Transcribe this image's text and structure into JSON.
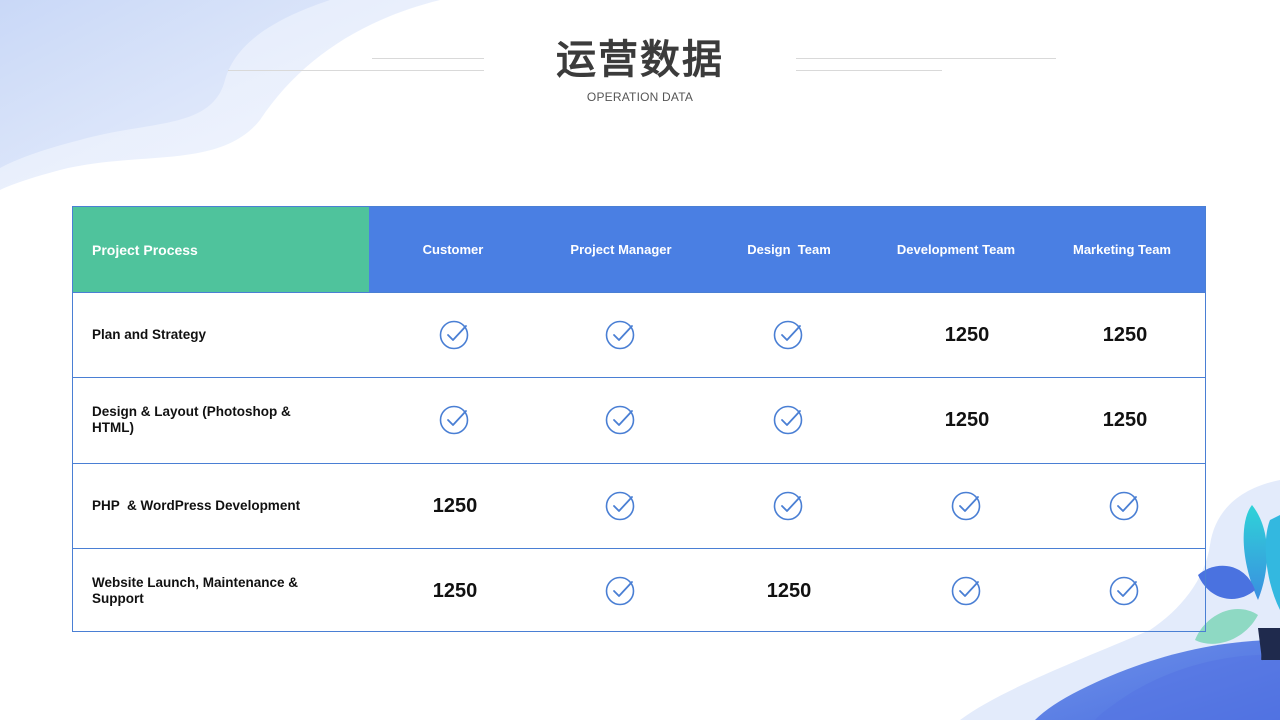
{
  "title": "运营数据",
  "subtitle": "OPERATION DATA",
  "colors": {
    "green": "#4fc39c",
    "blue": "#4a7fe3",
    "check": "#4a7fd4"
  },
  "table": {
    "process_header": "Project Process",
    "columns": [
      "Customer",
      "Project Manager",
      "Design  Team",
      "Development Team",
      "Marketing Team"
    ],
    "rows": [
      {
        "label": "Plan and Strategy",
        "cells": [
          {
            "type": "check"
          },
          {
            "type": "check"
          },
          {
            "type": "check"
          },
          {
            "type": "value",
            "text": "1250"
          },
          {
            "type": "value",
            "text": "1250"
          }
        ]
      },
      {
        "label": "Design & Layout (Photoshop & HTML)",
        "cells": [
          {
            "type": "check"
          },
          {
            "type": "check"
          },
          {
            "type": "check"
          },
          {
            "type": "value",
            "text": "1250"
          },
          {
            "type": "value",
            "text": "1250"
          }
        ]
      },
      {
        "label": "PHP  & WordPress Development",
        "cells": [
          {
            "type": "value",
            "text": "1250"
          },
          {
            "type": "check"
          },
          {
            "type": "check"
          },
          {
            "type": "check"
          },
          {
            "type": "check"
          }
        ]
      },
      {
        "label": "Website Launch, Maintenance & Support",
        "cells": [
          {
            "type": "value",
            "text": "1250"
          },
          {
            "type": "check"
          },
          {
            "type": "value",
            "text": "1250"
          },
          {
            "type": "check"
          },
          {
            "type": "check"
          }
        ]
      }
    ]
  }
}
